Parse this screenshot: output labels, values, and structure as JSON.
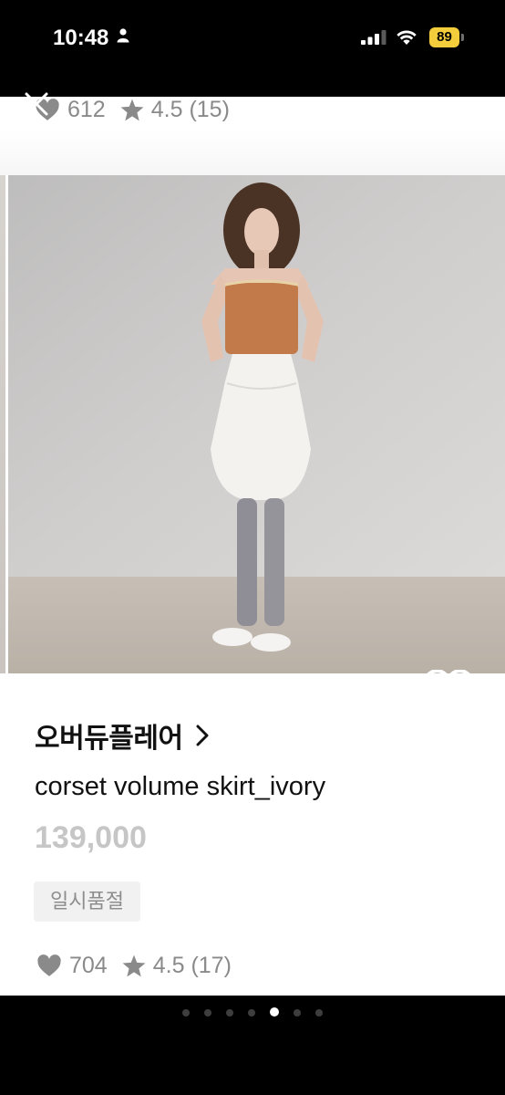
{
  "status_bar": {
    "time": "10:48",
    "battery": "89",
    "icons": [
      "person-icon",
      "signal-icon",
      "wifi-icon",
      "battery-icon"
    ]
  },
  "previous_item": {
    "likes": "612",
    "rating": "4.5",
    "reviews": "(15)"
  },
  "product": {
    "brand": "오버듀플레어",
    "name": "corset volume skirt_ivory",
    "price": "139,000",
    "status_badge": "일시품절",
    "likes": "704",
    "rating": "4.5",
    "reviews": "(17)",
    "image": "model-photo"
  },
  "pagination": {
    "count": 7,
    "active_index": 4
  },
  "colors": {
    "badge_bg": "#f1f1f1",
    "price": "#c6c6c6",
    "battery": "#f3cd3b"
  }
}
